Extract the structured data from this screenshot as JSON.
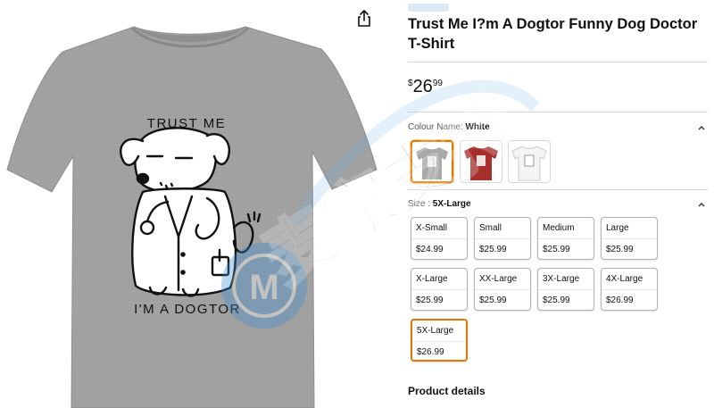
{
  "product": {
    "title": "Trust Me I?m A Dogtor Funny Dog Doctor T-Shirt",
    "price": {
      "symbol": "$",
      "whole": "26",
      "fraction": "99"
    }
  },
  "shirt": {
    "top_text": "TRUST ME",
    "bottom_text": "I'M A DOGTOR"
  },
  "colour": {
    "label": "Colour Name: ",
    "selected": "White",
    "swatches": [
      {
        "name": "grey",
        "color": "#a9a9a9"
      },
      {
        "name": "red",
        "color": "#a8302c"
      },
      {
        "name": "white",
        "color": "#f4f4f4"
      }
    ]
  },
  "size": {
    "label": "Size : ",
    "selected": "5X-Large",
    "options": [
      {
        "name": "X-Small",
        "price": "$24.99"
      },
      {
        "name": "Small",
        "price": "$25.99"
      },
      {
        "name": "Medium",
        "price": "$25.99"
      },
      {
        "name": "Large",
        "price": "$25.99"
      },
      {
        "name": "X-Large",
        "price": "$25.99"
      },
      {
        "name": "XX-Large",
        "price": "$25.99"
      },
      {
        "name": "3X-Large",
        "price": "$25.99"
      },
      {
        "name": "4X-Large",
        "price": "$26.99"
      },
      {
        "name": "5X-Large",
        "price": "$26.99"
      }
    ]
  },
  "details_heading": "Product details",
  "watermark": {
    "text": "麦家支持",
    "logo": "M"
  },
  "colors": {
    "accent": "#e77600",
    "shirt": "#9e9e9e"
  }
}
